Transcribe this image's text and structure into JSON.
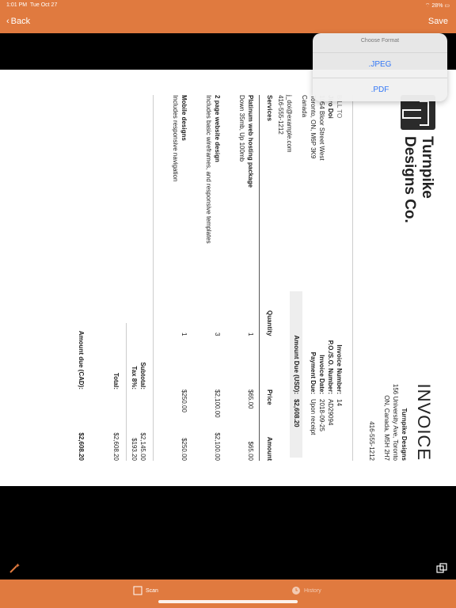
{
  "status": {
    "time": "1:01 PM",
    "date": "Tue Oct 27",
    "battery": "28%"
  },
  "nav": {
    "back_label": "Back",
    "save_label": "Save"
  },
  "popup": {
    "title": "Choose Format",
    "options": [
      ".JPEG",
      ".PDF"
    ]
  },
  "invoice": {
    "company_line1": "Turnpike",
    "company_line2": "Designs Co.",
    "title": "INVOICE",
    "from_name": "Turnpike Designs",
    "from_addr1": "156 University Ave, Toronto",
    "from_addr2": "ON, Canada,  M5H 2H7",
    "from_phone": "416-555-1212",
    "bill_to_label": "BILL TO",
    "client_name": "Jiro Doi",
    "client_addr1": "1954 Bloor Street West",
    "client_addr2": "Toronto, ON, M6P 3K9",
    "client_country": "Canada",
    "client_email": "j_doi@example.com",
    "client_phone": "416-555-1212",
    "meta_labels": [
      "Invoice Number:",
      "P.O./S.O. Number:",
      "Invoice Date:",
      "Payment Due:"
    ],
    "meta_values": [
      "14",
      "AD29094",
      "2018-09-25",
      "Upon receipt"
    ],
    "amount_due_label": "Amount Due (USD):",
    "amount_due_value": "$2,608.20",
    "headers": {
      "services": "Services",
      "quantity": "Quantity",
      "price": "Price",
      "amount": "Amount"
    },
    "items": [
      {
        "name": "Platinum web hosting package",
        "desc": "Down 35mb, Up 100mb",
        "qty": "1",
        "price": "$65.00",
        "amount": "$65.00"
      },
      {
        "name": "2 page website design",
        "desc": "Includes basic wireframes, and responsive templates",
        "qty": "3",
        "price": "$2,100.00",
        "amount": "$2,100.00"
      },
      {
        "name": "Mobile designs",
        "desc": "Includes responsive navigation",
        "qty": "1",
        "price": "$250.00",
        "amount": "$250.00"
      }
    ],
    "subtotal_label": "Subtotal:",
    "subtotal_value": "$2,145.00",
    "tax_label": "Tax 8%:",
    "tax_value": "$193.20",
    "total_label": "Total:",
    "total_value": "$2,608.20",
    "amount_due_cad_label": "Amount due (CAD):",
    "amount_due_cad_value": "$2,608.20"
  },
  "tabs": [
    {
      "label": "Scan"
    },
    {
      "label": "History"
    }
  ],
  "icons": {
    "wand": "magic-wand-icon",
    "copy": "copy-icon",
    "scan": "scan-icon",
    "history": "clock-icon"
  },
  "colors": {
    "accent": "#e07a3f",
    "link": "#3478f6"
  }
}
